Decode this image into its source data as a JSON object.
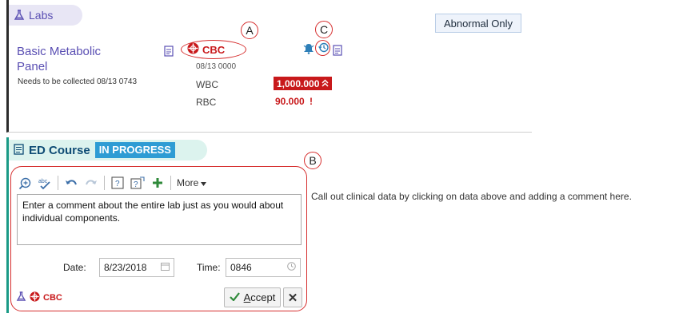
{
  "labs": {
    "title": "Labs",
    "abnormal_button": "Abnormal Only",
    "order_name": "Basic Metabolic Panel",
    "order_status": "Needs to be collected 08/13 0743",
    "result": {
      "name": "CBC",
      "time": "08/13 0000",
      "rows": [
        {
          "label": "WBC",
          "value": "1,000.000",
          "flag": "critical-high"
        },
        {
          "label": "RBC",
          "value": "90.000",
          "flag": "abnormal"
        }
      ]
    }
  },
  "callouts": {
    "a": "A",
    "b": "B",
    "c": "C"
  },
  "ed_course": {
    "title": "ED Course",
    "status": "IN PROGRESS",
    "toolbar": {
      "more": "More"
    },
    "comment": "Enter a comment about the entire lab just as you would about individual components.",
    "date_label": "Date:",
    "date_value": "8/23/2018",
    "time_label": "Time:",
    "time_value": "0846",
    "attached": "CBC",
    "accept_label": "ccept",
    "accept_accesskey": "A",
    "cancel_label": "✕",
    "hint": "Call out clinical data by clicking on data above and adding a comment here."
  },
  "colors": {
    "labs_accent": "#5a4fb3",
    "critical": "#c8191b",
    "ed_accent": "#1a9a86",
    "in_progress": "#2e9cd4",
    "callout_red": "#d62f2f"
  },
  "icons": [
    "flask-icon",
    "report-icon",
    "cbc-lab-icon",
    "bell-icon",
    "history-icon",
    "double-up-arrow-icon",
    "exclamation-icon",
    "zoom-icon",
    "spellcheck-icon",
    "undo-icon",
    "redo-icon",
    "smartphrase-icon",
    "smartlink-icon",
    "add-icon",
    "calendar-icon",
    "clock-icon",
    "checkmark-icon",
    "close-icon"
  ]
}
